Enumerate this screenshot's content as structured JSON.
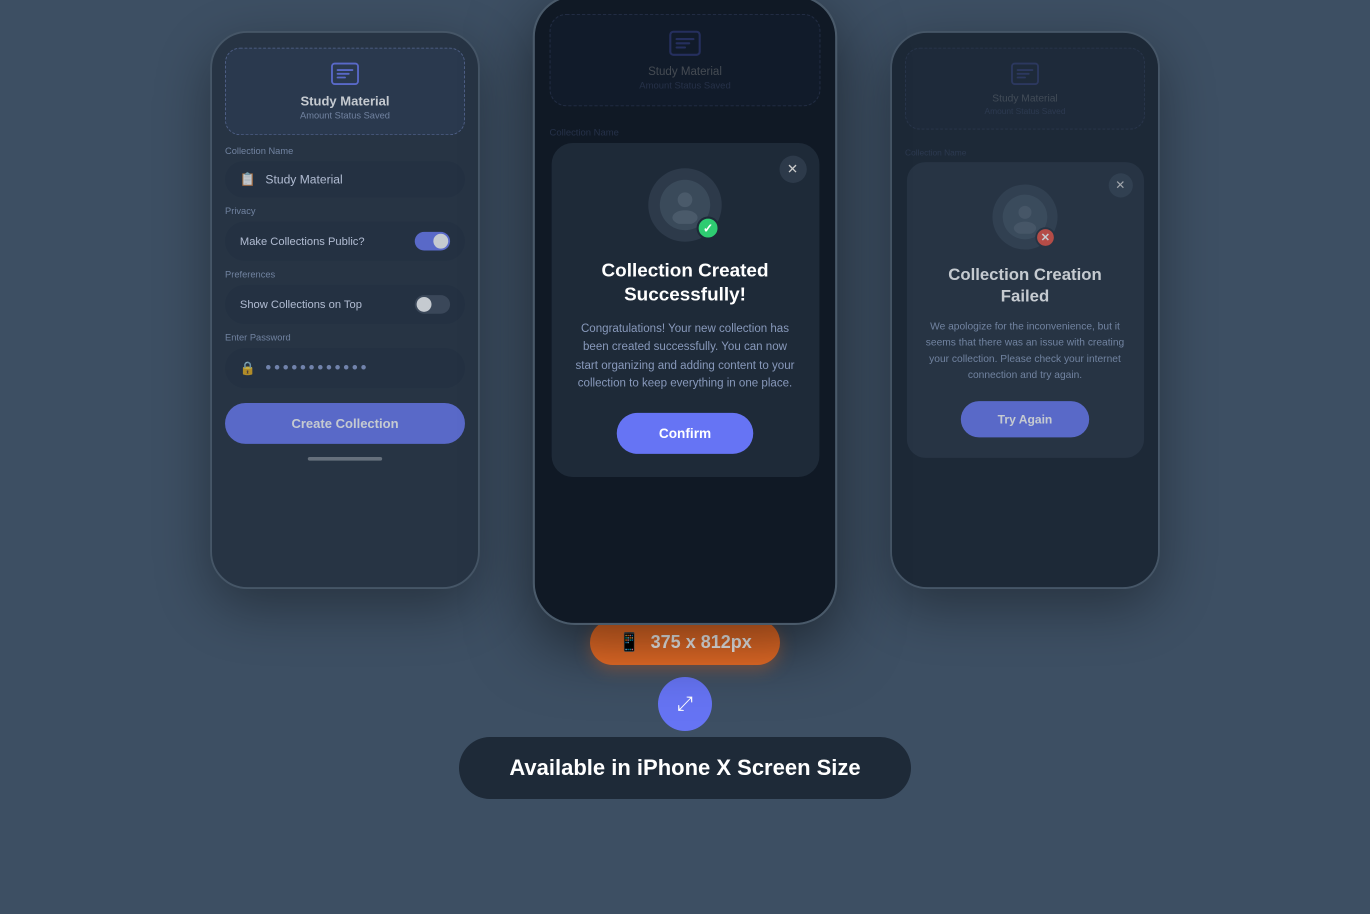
{
  "page": {
    "background": "#3d4f63"
  },
  "phones": {
    "left": {
      "widget": {
        "title": "Study Material",
        "subtitle": "Amount Status Saved"
      },
      "form": {
        "collection_name_label": "Collection Name",
        "collection_name_value": "Study Material",
        "privacy_label": "Privacy",
        "privacy_option": "Make Collections Public?",
        "privacy_toggle": "on",
        "preferences_label": "Preferences",
        "preferences_option": "Show Collections on Top",
        "preferences_toggle": "off",
        "password_label": "Enter Password",
        "password_value": "••••••••••••",
        "create_button": "Create Collection"
      }
    },
    "center": {
      "widget": {
        "title": "Study Material",
        "subtitle": "Amount Status Saved"
      },
      "collection_name_label": "Collection Name",
      "modal": {
        "title": "Collection Created Successfully!",
        "body": "Congratulations! Your new collection has been created successfully. You can now start organizing and adding content to your collection to keep everything in one place.",
        "confirm_button": "Confirm",
        "status": "success"
      }
    },
    "right": {
      "widget": {
        "title": "Study Material",
        "subtitle": "Amount Status Saved"
      },
      "collection_name_label": "Collection Name",
      "modal": {
        "title": "Collection Creation Failed",
        "body": "We apologize for the inconvenience, but it seems that there was an issue with creating your collection. Please check your internet connection and try again.",
        "confirm_button": "Try Again",
        "status": "fail"
      }
    }
  },
  "size_badge": {
    "icon": "📱",
    "label": "375 x 812px"
  },
  "available_label": "Available in iPhone X Screen Size",
  "compress_icon": "⤢"
}
